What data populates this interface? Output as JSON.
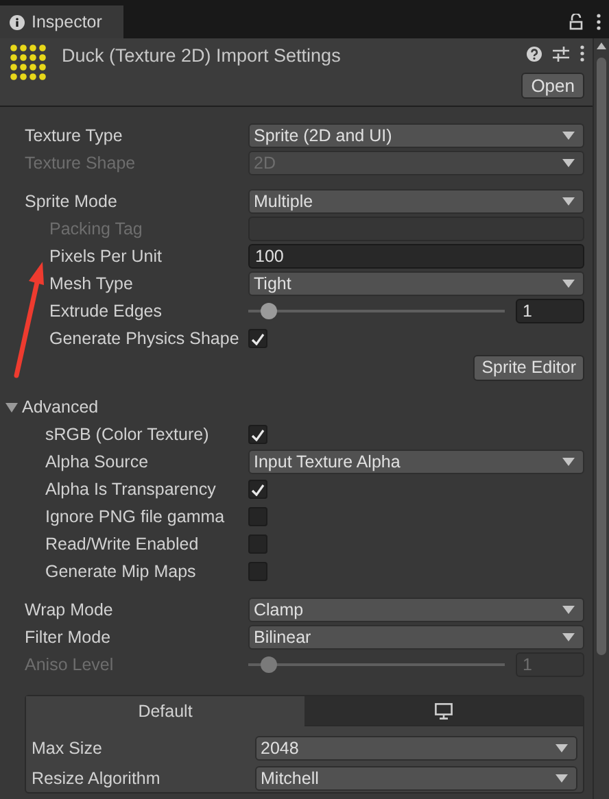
{
  "tab": {
    "title": "Inspector",
    "selected": true
  },
  "header": {
    "title": "Duck (Texture 2D) Import Settings",
    "open_button": "Open"
  },
  "groups": [
    [
      {
        "kind": "dropdown",
        "label": "Texture Type",
        "value": "Sprite (2D and UI)",
        "disabled": false
      },
      {
        "kind": "dropdown",
        "label": "Texture Shape",
        "value": "2D",
        "disabled": true
      }
    ],
    [
      {
        "kind": "dropdown",
        "label": "Sprite Mode",
        "value": "Multiple",
        "disabled": false,
        "children": [
          {
            "kind": "text",
            "label": "Packing Tag",
            "disabled": true
          },
          {
            "kind": "text",
            "label": "Pixels Per Unit",
            "value": "100",
            "disabled": false
          },
          {
            "kind": "dropdown",
            "label": "Mesh Type",
            "value": "Tight",
            "disabled": false
          },
          {
            "kind": "slider",
            "label": "Extrude Edges",
            "value": "1",
            "level": 0.05,
            "disabled": false
          },
          {
            "kind": "checkbox",
            "label": "Generate Physics Shape",
            "checked": true,
            "disabled": false
          },
          {
            "kind": "button",
            "label": "Sprite Editor"
          }
        ]
      }
    ],
    [
      {
        "kind": "foldout",
        "label": "Advanced",
        "expanded": true,
        "children": [
          {
            "kind": "checkbox",
            "label": "sRGB (Color Texture)",
            "checked": true,
            "disabled": false
          },
          {
            "kind": "dropdown",
            "label": "Alpha Source",
            "value": "Input Texture Alpha",
            "disabled": false
          },
          {
            "kind": "checkbox",
            "label": "Alpha Is Transparency",
            "checked": true,
            "disabled": false
          },
          {
            "kind": "checkbox",
            "label": "Ignore PNG file gamma",
            "checked": false,
            "disabled": false
          },
          {
            "kind": "checkbox",
            "label": "Read/Write Enabled",
            "checked": false,
            "disabled": false
          },
          {
            "kind": "checkbox",
            "label": "Generate Mip Maps",
            "checked": false,
            "disabled": false
          }
        ]
      }
    ],
    [
      {
        "kind": "dropdown",
        "label": "Wrap Mode",
        "value": "Clamp",
        "disabled": false
      },
      {
        "kind": "dropdown",
        "label": "Filter Mode",
        "value": "Bilinear",
        "disabled": false
      },
      {
        "kind": "slider",
        "label": "Aniso Level",
        "value": "1",
        "level": 0.05,
        "disabled": true
      }
    ]
  ],
  "platform": {
    "tabs": [
      {
        "kind": "text",
        "label": "Default",
        "selected": true
      },
      {
        "kind": "monitor",
        "selected": false
      }
    ],
    "rows": [
      {
        "kind": "dropdown",
        "label": "Max Size",
        "value": "2048",
        "disabled": false
      },
      {
        "kind": "dropdown",
        "label": "Resize Algorithm",
        "value": "Mitchell",
        "disabled": false
      }
    ]
  }
}
